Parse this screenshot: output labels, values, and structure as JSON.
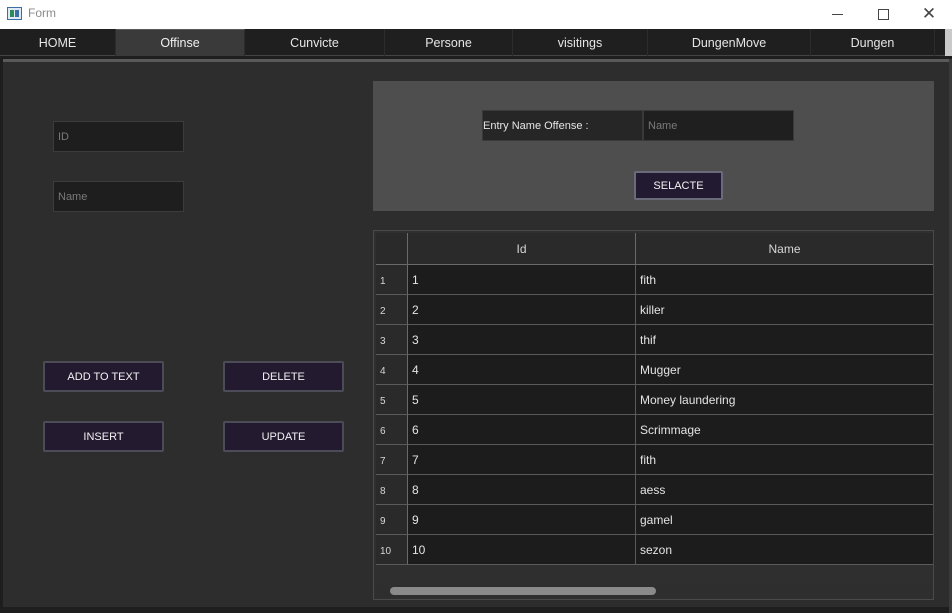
{
  "window": {
    "title": "Form",
    "controls": {
      "minimize_icon": "minimize-icon",
      "maximize_icon": "maximize-icon",
      "close_icon": "close-icon",
      "close_glyph": "✕"
    }
  },
  "tabs": [
    {
      "label": "HOME",
      "active": false
    },
    {
      "label": "Offinse",
      "active": true
    },
    {
      "label": "Cunvicte",
      "active": false
    },
    {
      "label": "Persone",
      "active": false
    },
    {
      "label": "visitings",
      "active": false
    },
    {
      "label": "DungenMove",
      "active": false
    },
    {
      "label": "Dungen",
      "active": false
    }
  ],
  "form": {
    "id_placeholder": "ID",
    "name_placeholder": "Name",
    "buttons": {
      "add_to_text": "ADD TO TEXT",
      "delete": "DELETE",
      "insert": "INSERT",
      "update": "UPDATE"
    }
  },
  "search": {
    "label": "Entry Name Offense :",
    "placeholder": "Name",
    "button": "SELACTE"
  },
  "table": {
    "columns": [
      "Id",
      "Name"
    ],
    "rows": [
      {
        "num": "1",
        "id": "1",
        "name": "fith"
      },
      {
        "num": "2",
        "id": "2",
        "name": "killer"
      },
      {
        "num": "3",
        "id": "3",
        "name": "thif"
      },
      {
        "num": "4",
        "id": "4",
        "name": "Mugger"
      },
      {
        "num": "5",
        "id": "5",
        "name": "Money laundering"
      },
      {
        "num": "6",
        "id": "6",
        "name": "Scrimmage"
      },
      {
        "num": "7",
        "id": "7",
        "name": "fith"
      },
      {
        "num": "8",
        "id": "8",
        "name": "aess"
      },
      {
        "num": "9",
        "id": "9",
        "name": "gamel"
      },
      {
        "num": "10",
        "id": "10",
        "name": "sezon"
      }
    ]
  },
  "colors": {
    "background": "#2d2d2d",
    "button_bg": "#231a30",
    "search_panel": "#4e4e4e",
    "cell_bg": "#1c1c1c"
  }
}
